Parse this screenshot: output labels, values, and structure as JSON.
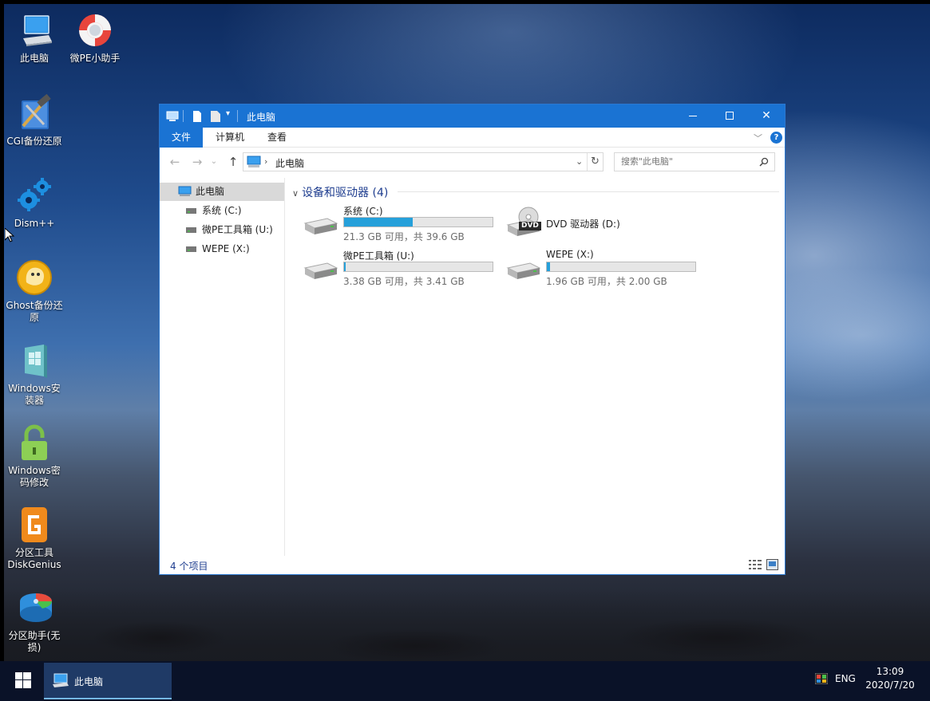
{
  "desktop": {
    "icons": [
      {
        "label": "此电脑",
        "icon": "computer-icon"
      },
      {
        "label": "微PE小助手",
        "icon": "lifebuoy-icon"
      },
      {
        "label": "CGI备份还原",
        "icon": "hammer-tools-icon"
      },
      {
        "label": "Dism++",
        "icon": "gears-icon"
      },
      {
        "label": "Ghost备份还原",
        "icon": "ghost-icon"
      },
      {
        "label": "Windows安装器",
        "icon": "windows-installer-icon"
      },
      {
        "label": "Windows密码修改",
        "icon": "padlock-icon"
      },
      {
        "label": "分区工具DiskGenius",
        "icon": "diskgenius-icon"
      },
      {
        "label": "分区助手(无损)",
        "icon": "partition-assistant-icon"
      }
    ]
  },
  "explorer": {
    "title": "此电脑",
    "ribbon_tabs": [
      "文件",
      "计算机",
      "查看"
    ],
    "address": "此电脑",
    "search_placeholder": "搜索\"此电脑\"",
    "nav": {
      "root": "此电脑",
      "items": [
        "系统 (C:)",
        "微PE工具箱 (U:)",
        "WEPE (X:)"
      ]
    },
    "group_header": "设备和驱动器 (4)",
    "drives": [
      {
        "name": "系统 (C:)",
        "info": "21.3 GB 可用，共 39.6 GB",
        "used_fraction": 0.46
      },
      {
        "name": "DVD 驱动器 (D:)",
        "info": "",
        "used_fraction": null
      },
      {
        "name": "微PE工具箱 (U:)",
        "info": "3.38 GB 可用，共 3.41 GB",
        "used_fraction": 0.01
      },
      {
        "name": "WEPE (X:)",
        "info": "1.96 GB 可用，共 2.00 GB",
        "used_fraction": 0.02
      }
    ],
    "dvd_badge": "DVD",
    "status": "4 个项目",
    "accent": "#1a73d3"
  },
  "taskbar": {
    "app_label": "此电脑",
    "lang": "ENG",
    "time": "13:09",
    "date": "2020/7/20"
  }
}
